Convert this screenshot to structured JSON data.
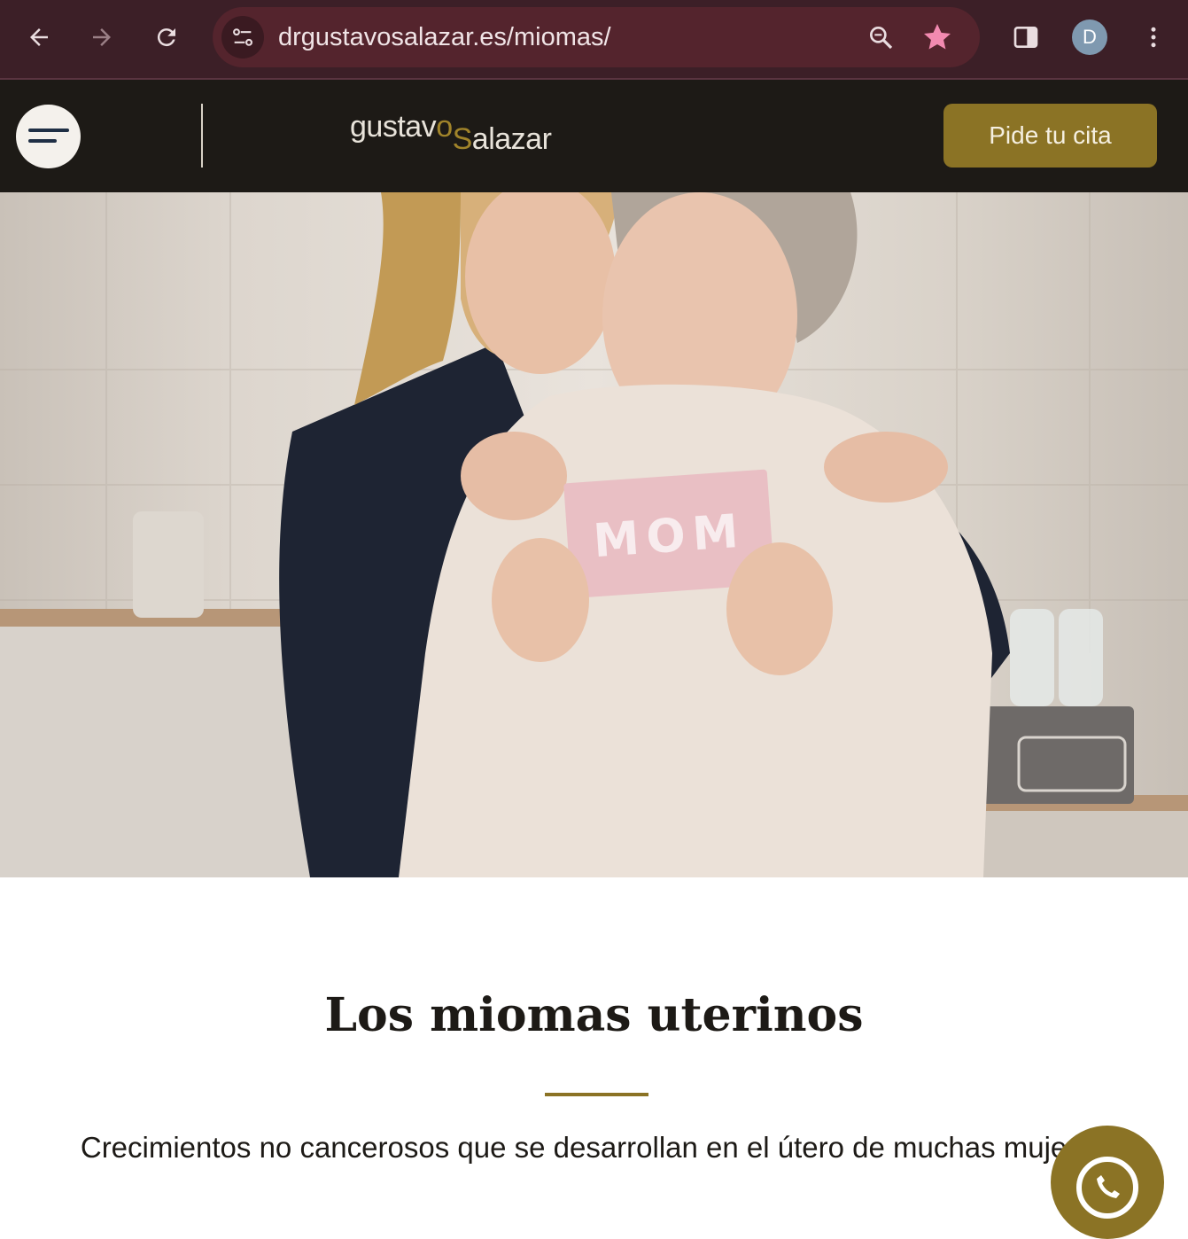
{
  "browser": {
    "url": "drgustavosalazar.es/miomas/",
    "profile_initial": "D",
    "icons": [
      "back-arrow-icon",
      "forward-arrow-icon",
      "reload-icon",
      "site-settings-icon",
      "zoom-icon",
      "bookmark-star-icon",
      "side-panel-icon",
      "more-vert-icon"
    ],
    "star_color": "#f28ab0"
  },
  "header": {
    "logo_part_a": "gustav",
    "logo_accent_o": "o",
    "logo_accent_s": "S",
    "logo_part_b": "alazar",
    "cta_label": "Pide tu cita",
    "accent_color": "#8b7325"
  },
  "hero": {
    "card_text": "MOM"
  },
  "main": {
    "title": "Los miomas uterinos",
    "subtitle": "Crecimientos no cancerosos que se desarrollan en el útero de muchas mujeres"
  }
}
